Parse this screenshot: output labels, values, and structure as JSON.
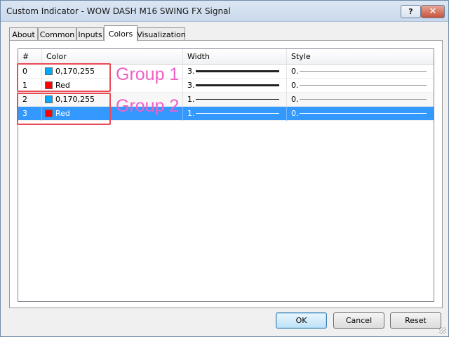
{
  "window": {
    "title": "Custom Indicator - WOW DASH M16 SWING FX Signal",
    "help_label": "?",
    "close_label": "✕"
  },
  "tabs": [
    {
      "label": "About",
      "active": false
    },
    {
      "label": "Common",
      "active": false
    },
    {
      "label": "Inputs",
      "active": false
    },
    {
      "label": "Colors",
      "active": true
    },
    {
      "label": "Visualization",
      "active": false
    }
  ],
  "table": {
    "headers": [
      "#",
      "Color",
      "Width",
      "Style"
    ],
    "rows": [
      {
        "index": "0",
        "color_label": "0,170,255",
        "swatch": "#00aaff",
        "width": "3.",
        "style": "0.",
        "selected": false
      },
      {
        "index": "1",
        "color_label": "Red",
        "swatch": "#ff0000",
        "width": "3.",
        "style": "0.",
        "selected": false
      },
      {
        "index": "2",
        "color_label": "0,170,255",
        "swatch": "#00aaff",
        "width": "1.",
        "style": "0.",
        "selected": false
      },
      {
        "index": "3",
        "color_label": "Red",
        "swatch": "#ff0000",
        "width": "1.",
        "style": "0.",
        "selected": true
      }
    ]
  },
  "annotations": {
    "group1": "Group 1",
    "group2": "Group 2"
  },
  "buttons": {
    "ok": "OK",
    "cancel": "Cancel",
    "reset": "Reset"
  }
}
